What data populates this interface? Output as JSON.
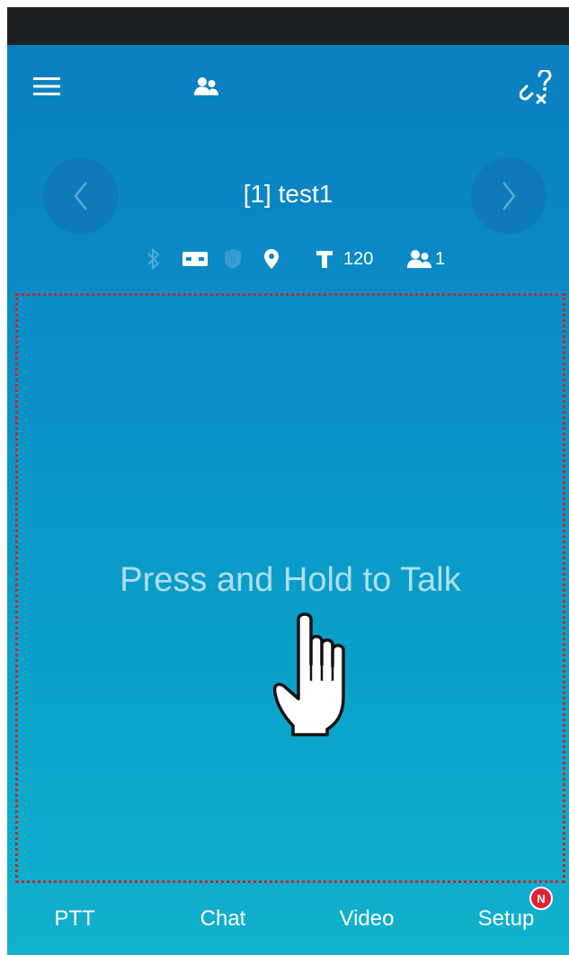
{
  "header": {
    "channel_title": "[1] test1"
  },
  "info_row": {
    "bluetooth_icon": "bluetooth-icon",
    "card_icon": "card-icon",
    "shield_icon": "shield-icon",
    "location_icon": "location-icon",
    "text_icon": "text-icon",
    "text_count": "120",
    "members_icon": "members-icon",
    "member_count": "1"
  },
  "talk_area": {
    "prompt": "Press and Hold to Talk"
  },
  "bottom_nav": {
    "tabs": [
      {
        "label": "PTT"
      },
      {
        "label": "Chat"
      },
      {
        "label": "Video"
      },
      {
        "label": "Setup"
      }
    ],
    "setup_badge": "N"
  },
  "colors": {
    "background_top": "#0a7fc0",
    "background_bottom": "#11b1cd",
    "status_bar": "#1e2124",
    "badge": "#e02234",
    "talk_border": "#c42a2a"
  }
}
